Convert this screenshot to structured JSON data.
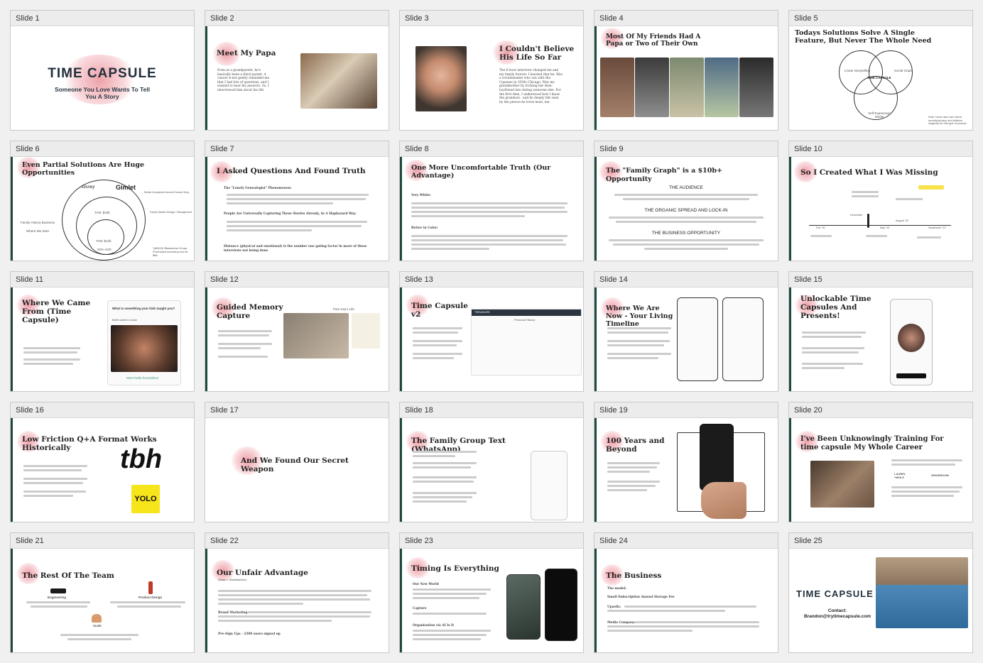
{
  "slides": [
    {
      "label": "Slide 1",
      "title": "",
      "brand": "TIME CAPSULE",
      "tagline": "Someone You Love Wants To Tell You A Story"
    },
    {
      "label": "Slide 2",
      "title": "Meet My Papa",
      "text": "Even as a grandparent, he's basically been a third parent. A cancer scare gently reminded me that I had lots of questions, and I wanted to hear his answers. So, I interviewed him about his life."
    },
    {
      "label": "Slide 3",
      "title": "I Couldn't Believe His Life So Far",
      "text": "The 6-hour interview changed me and my family forever. I learned that he: Was a troublemaker who ran with the Capones in 1930s Chicago. Won my grandmother by tricking her then-boyfriend into dating someone else. For the first time, I understood how I know the grandson - and he deeply felt seen by the person he loves most, me."
    },
    {
      "label": "Slide 4",
      "title": "Most Of My Friends Had A Papa or Two of Their Own"
    },
    {
      "label": "Slide 5",
      "title": "Todays Solutions Solve A Single Feature, But Never The Whole Need",
      "venn": [
        "Linear Storytelling",
        "Social Graph",
        "Self-Expression Media"
      ],
      "center": "TIME CAPSULE",
      "note": "Note: Users also care about security/privacy and platform longevity for this type of product"
    },
    {
      "label": "Slide 6",
      "title": "Even Partial Solutions Are Huge Opportunities",
      "logos": [
        "Gimlet",
        "Disney"
      ],
      "tam1": "TAM: $15b",
      "tam2": "TAM: $12b",
      "cagr": "20% AGR",
      "labels": [
        "Family History Business",
        "Where We Start",
        "Media Companies Around Human Story",
        "Family Media Storage / Management"
      ],
      "footnote": "*(8/6/20) Blackstone Group Purchased Ancestry.com for $8b"
    },
    {
      "label": "Slide 7",
      "title": "I Asked Questions And Found Truth",
      "text1": "The \"Lonely Genealogist\" Phenomenon:",
      "text2": "People Are Universally Capturing These Stories Already, In A Haphazard Way.",
      "text3": "Distance (physical and emotional) is the number one gating factor in more of these interviews not being done"
    },
    {
      "label": "Slide 8",
      "title": "One More Uncomfortable Truth (Our Advantage)",
      "sub1": "Very White:",
      "sub2": "Better in Color:"
    },
    {
      "label": "Slide 9",
      "title": "The \"Family Graph\" is a $10b+ Opportunity",
      "h1": "THE AUDIENCE",
      "h2": "THE ORGANIC SPREAD AND LOCK-IN",
      "h3": "THE BUSINESS OPPORTUNITY"
    },
    {
      "label": "Slide 10",
      "title": "So I Created What I Was Missing",
      "months": [
        "Feb '20",
        "December",
        "May '20",
        "August '20",
        "September '20"
      ]
    },
    {
      "label": "Slide 11",
      "title": "Where We Came From (Time Capsule)",
      "question": "What is something your kids taught you?",
      "caption": "Brett wants to know",
      "footer": "Meet Nelly Rosenblum"
    },
    {
      "label": "Slide 12",
      "title": "Guided Memory Capture",
      "header": "Pam Key's Life"
    },
    {
      "label": "Slide 13",
      "title": "Time Capsule v2",
      "app": "TREASURE",
      "panel": "Personal History"
    },
    {
      "label": "Slide 14",
      "title": "Where We Are Now - Your Living Timeline"
    },
    {
      "label": "Slide 15",
      "title": "Unlockable Time Capsules And Presents!"
    },
    {
      "label": "Slide 16",
      "title": "Low Friction Q+A Format Works Historically",
      "logo1": "tbh",
      "logo2": "YOLO"
    },
    {
      "label": "Slide 17",
      "title": "And We Found Our Secret Weapon"
    },
    {
      "label": "Slide 18",
      "title": "The Family Group Text (WhatsApp)"
    },
    {
      "label": "Slide 19",
      "title": "100 Years and Beyond"
    },
    {
      "label": "Slide 20",
      "title": "I've Been Unknowingly Training For time capsule My Whole Career",
      "logos": [
        "LAUREL +WOLF",
        "SHOWROOM"
      ]
    },
    {
      "label": "Slide 21",
      "title": "The Rest Of The Team",
      "roles": [
        "Engineering",
        "Product Design",
        "Scale"
      ]
    },
    {
      "label": "Slide 22",
      "title": "Our Unfair Advantage",
      "sub": "(Data + distribution)",
      "brandMarketing": "Brand Marketing",
      "presignups": "Pre-Sign Ups - 2300 users signed up"
    },
    {
      "label": "Slide 23",
      "title": "Timing Is Everything",
      "p1": "Our New World",
      "p2": "Capture",
      "p3": "Organization via AI Is It"
    },
    {
      "label": "Slide 24",
      "title": "The Business",
      "model": "The model:",
      "fee": "Small Subscription Annual Storage Fee",
      "upsells": "Upsells:",
      "media": "Media Company:"
    },
    {
      "label": "Slide 25",
      "title": "",
      "brand": "TIME CAPSULE",
      "contactLabel": "Contact:",
      "email": "Brandon@trytimecapsule.com"
    }
  ],
  "colors": {
    "accent": "#e8828c",
    "bar": "#1d4a3c",
    "brand": "#22303c"
  }
}
